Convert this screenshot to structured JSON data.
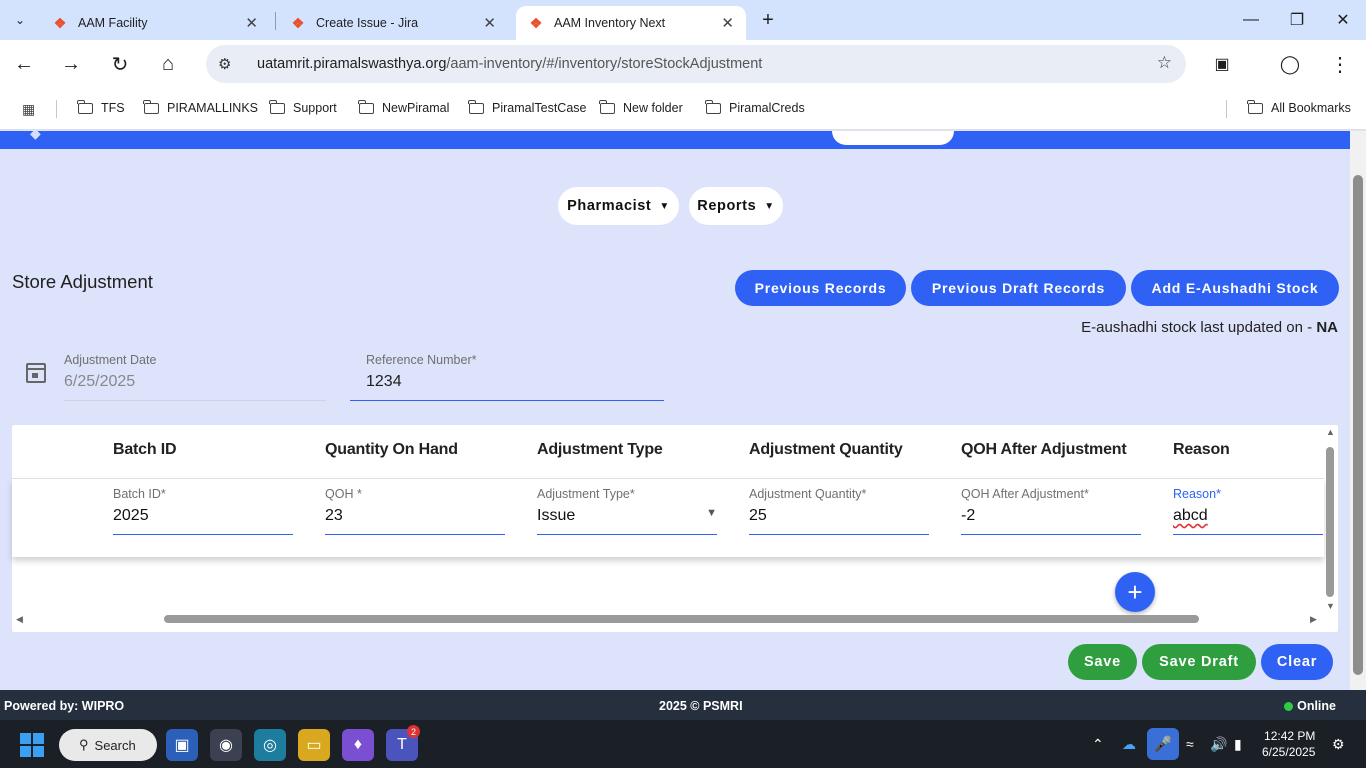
{
  "browser": {
    "tabs": [
      {
        "title": "AAM Facility"
      },
      {
        "title": "Create Issue - Jira"
      },
      {
        "title": "AAM Inventory Next"
      }
    ],
    "url_host": "uatamrit.piramalswasthya.org",
    "url_path": "/aam-inventory/#/inventory/storeStockAdjustment",
    "bookmarks": [
      "TFS",
      "PIRAMALLINKS",
      "Support",
      "NewPiramal",
      "PiramalTestCase",
      "New folder",
      "PiramalCreds"
    ],
    "all_bookmarks": "All Bookmarks"
  },
  "nav": {
    "pharmacist": "Pharmacist",
    "reports": "Reports"
  },
  "page": {
    "title": "Store Adjustment",
    "buttons": {
      "previous_records": "Previous Records",
      "previous_draft_records": "Previous Draft Records",
      "add_eaushadhi": "Add E-Aushadhi Stock"
    },
    "eaushadhi_prefix": "E-aushadhi stock last updated on - ",
    "eaushadhi_value": "NA",
    "adjustment_date_label": "Adjustment Date",
    "adjustment_date_value": "6/25/2025",
    "reference_label": "Reference Number*",
    "reference_value": "1234"
  },
  "table": {
    "headers": [
      "Batch ID",
      "Quantity On Hand",
      "Adjustment Type",
      "Adjustment Quantity",
      "QOH After Adjustment",
      "Reason"
    ],
    "row": {
      "batch_label": "Batch ID*",
      "batch_value": "2025",
      "qoh_label": "QOH *",
      "qoh_value": "23",
      "type_label": "Adjustment Type*",
      "type_value": "Issue",
      "qty_label": "Adjustment Quantity*",
      "qty_value": "25",
      "after_label": "QOH After Adjustment*",
      "after_value": "-2",
      "reason_label": "Reason*",
      "reason_value": "abcd"
    }
  },
  "actions": {
    "save": "Save",
    "save_draft": "Save Draft",
    "clear": "Clear"
  },
  "footer": {
    "powered": "Powered by: WIPRO",
    "copyright": "2025 © PSMRI",
    "status": "Online"
  },
  "taskbar": {
    "search": "Search",
    "time": "12:42 PM",
    "date": "6/25/2025",
    "teams_badge": "2"
  },
  "colors": {
    "primary": "#2f62f4",
    "success": "#2e9e3f",
    "page_bg": "#dde3fb"
  }
}
